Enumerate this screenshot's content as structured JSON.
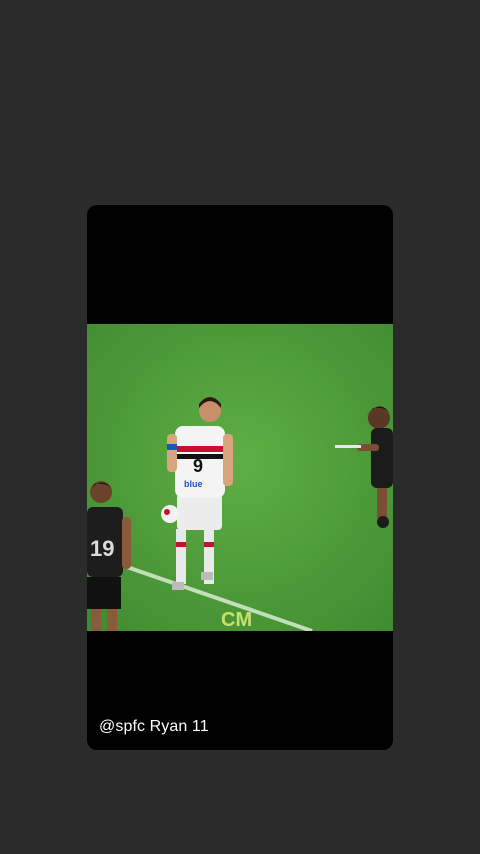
{
  "story": {
    "caption": "@spfc Ryan 11",
    "watermark": "CM"
  },
  "colors": {
    "background": "#2c2b2b",
    "card": "#000000",
    "pitch": "#4f9a3a",
    "caption_text": "#ffffff"
  }
}
